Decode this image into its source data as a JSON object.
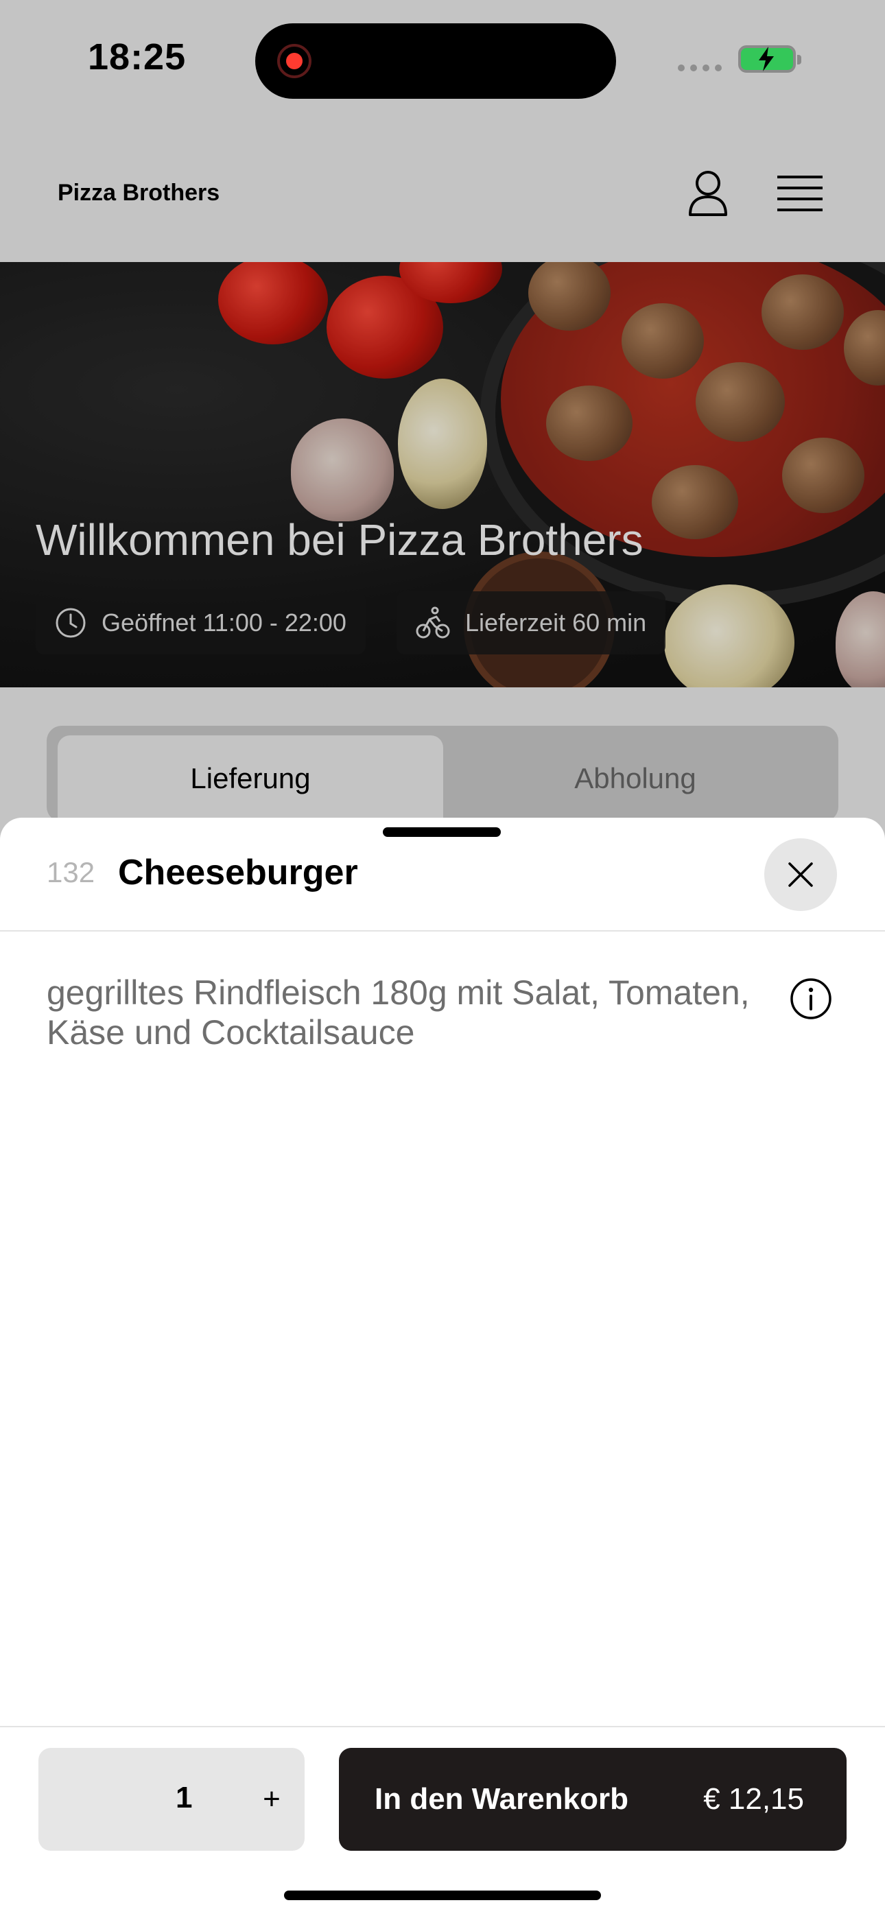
{
  "status_bar": {
    "time": "18:25"
  },
  "header": {
    "brand": "Pizza Brothers"
  },
  "hero": {
    "title": "Willkommen bei Pizza Brothers",
    "opening_hours": "Geöffnet 11:00 - 22:00",
    "delivery_time": "Lieferzeit 60 min"
  },
  "tabs": {
    "delivery": "Lieferung",
    "pickup": "Abholung"
  },
  "item": {
    "number": "132",
    "name": "Cheeseburger",
    "description": "gegrilltes Rindfleisch 180g mit Salat, Tomaten, Käse und Cocktailsauce"
  },
  "footer": {
    "quantity": "1",
    "plus": "+",
    "add_to_cart": "In den Warenkorb",
    "price": "€ 12,15"
  },
  "colors": {
    "dim_background": "#c4c4c4",
    "cart_button": "#1f1b1b",
    "battery": "#34c759"
  },
  "icons": [
    "record-icon",
    "battery-charging-icon",
    "user-icon",
    "menu-icon",
    "clock-icon",
    "bicycle-icon",
    "close-icon",
    "info-icon"
  ]
}
